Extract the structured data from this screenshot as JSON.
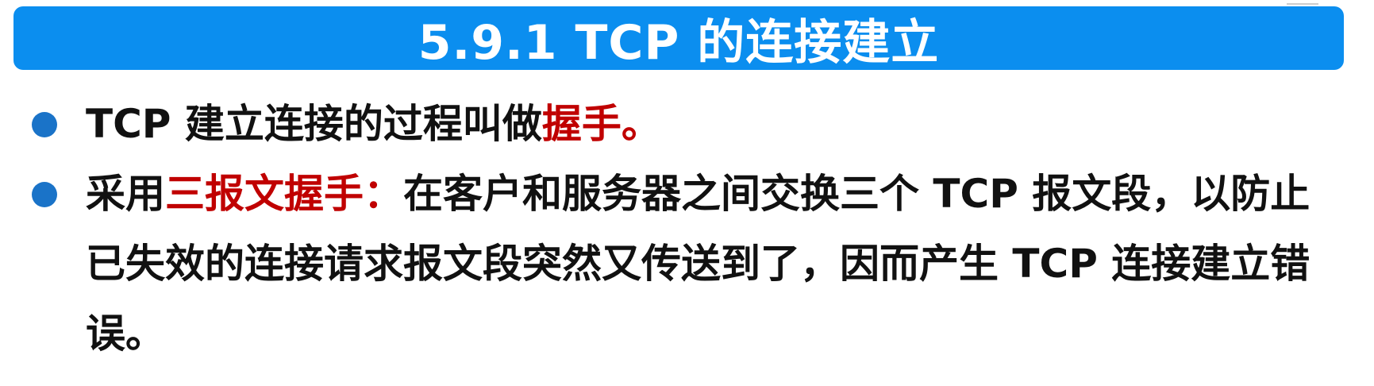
{
  "title": "5.9.1  TCP 的连接建立",
  "bullets": [
    {
      "text_before": "TCP 建立连接的过程叫做",
      "highlight": "握手。",
      "text_after": ""
    },
    {
      "text_before": "采用",
      "highlight": "三报文握手：",
      "text_after": "在客户和服务器之间交换三个 TCP 报文段，以防止已失效的连接请求报文段突然又传送到了，因而产生 TCP 连接建立错误。"
    }
  ],
  "colors": {
    "title_background": "#0b8eef",
    "highlight": "#c00000",
    "bullet": "#1a73c8"
  }
}
